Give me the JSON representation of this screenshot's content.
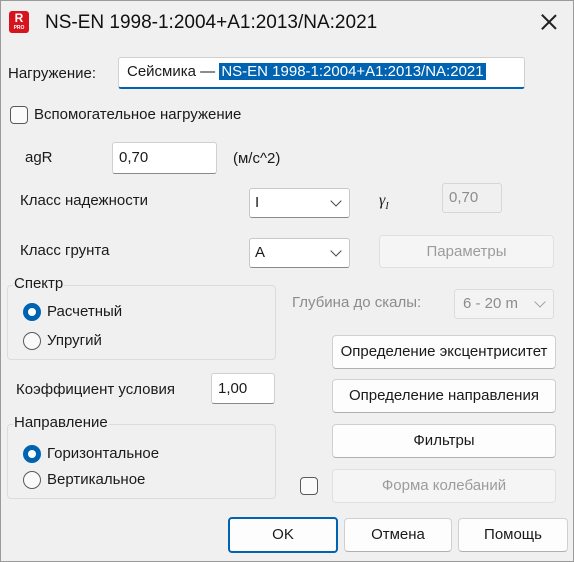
{
  "window": {
    "title": "NS-EN 1998-1:2004+A1:2013/NA:2021",
    "app_icon_letter": "R",
    "app_icon_sub": "PRO"
  },
  "load_name": {
    "label": "Нагружение:",
    "prefix": "Сейсмика — ",
    "selected": "NS-EN 1998-1:2004+A1:2013/NA:2021"
  },
  "auxiliary": {
    "label": "Вспомогательное нагружение",
    "checked": false
  },
  "agr": {
    "label": "agR",
    "value": "0,70",
    "unit": "(м/с^2)"
  },
  "reliability": {
    "label": "Класс надежности",
    "value": "I",
    "gamma_symbol": "γ",
    "gamma_sub": "I",
    "gamma_value": "0,70"
  },
  "soil": {
    "label": "Класс грунта",
    "value": "A",
    "params_button": "Параметры"
  },
  "spectrum": {
    "legend": "Спектр",
    "options": [
      "Расчетный",
      "Упругий"
    ],
    "selected": 0
  },
  "depth": {
    "label": "Глубина до скалы:",
    "value": "6 - 20 m"
  },
  "buttons": {
    "eccentricity": "Определение эксцентриситет",
    "direction": "Определение направления",
    "filters": "Фильтры",
    "mode_shapes": "Форма колебаний",
    "ok": "OK",
    "cancel": "Отмена",
    "help": "Помощь"
  },
  "mode_shapes_checked": false,
  "condition_factor": {
    "label": "Коэффициент условия",
    "value": "1,00"
  },
  "direction": {
    "legend": "Направление",
    "options": [
      "Горизонтальное",
      "Вертикальное"
    ],
    "selected": 0
  },
  "colors": {
    "accent": "#0063b1",
    "app_icon": "#d5141e"
  }
}
